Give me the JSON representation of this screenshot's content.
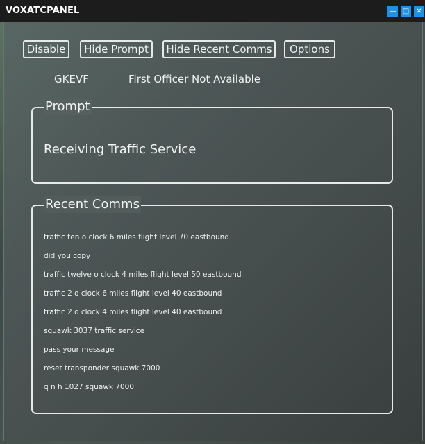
{
  "window": {
    "title": "VOXATCPANEL",
    "controls": {
      "minimize_icon": "minimize-icon",
      "popout_icon": "popout-icon",
      "close_icon": "close-icon"
    }
  },
  "toolbar": {
    "disable_label": "Disable",
    "hide_prompt_label": "Hide Prompt",
    "hide_recent_comms_label": "Hide Recent Comms",
    "options_label": "Options"
  },
  "status": {
    "callsign": "GKEVF",
    "first_officer": "First Officer Not Available"
  },
  "prompt": {
    "legend": "Prompt",
    "text": "Receiving Traffic Service"
  },
  "recent_comms": {
    "legend": "Recent Comms",
    "items": [
      "traffic ten o clock 6 miles flight level 70 eastbound",
      "did you copy",
      "traffic twelve o clock 4 miles flight level 50 eastbound",
      "traffic 2 o clock 6 miles flight level 40 eastbound",
      "traffic 2 o clock 4 miles flight level 40 eastbound",
      "squawk 3037 traffic service",
      "pass your message",
      "reset transponder squawk 7000",
      "q n h 1027 squawk 7000"
    ]
  },
  "colors": {
    "titlebar": "#1c1c1c",
    "window_button": "#1e90e6",
    "panel": "#4a5252",
    "text": "#eef2f1"
  }
}
